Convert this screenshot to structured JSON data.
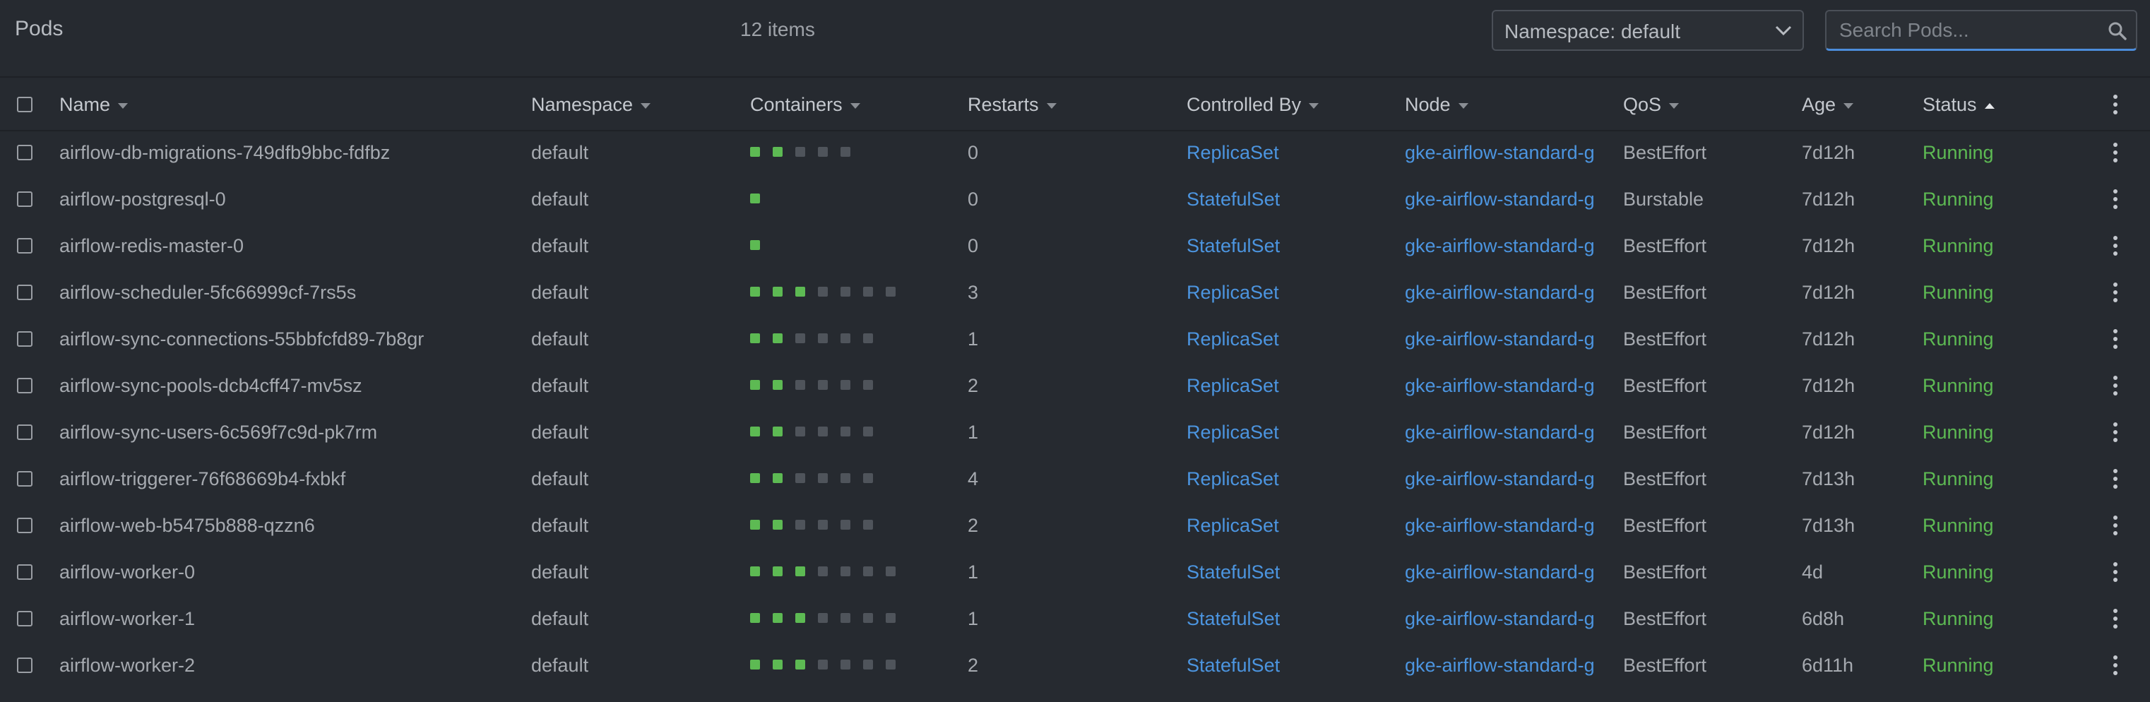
{
  "header": {
    "title": "Pods",
    "count": "12 items",
    "namespace_select": "Namespace: default",
    "search_placeholder": "Search Pods..."
  },
  "columns": {
    "name": "Name",
    "namespace": "Namespace",
    "containers": "Containers",
    "restarts": "Restarts",
    "controlled_by": "Controlled By",
    "node": "Node",
    "qos": "QoS",
    "age": "Age",
    "status": "Status"
  },
  "colors": {
    "background": "#262a30",
    "link": "#4c95e0",
    "running": "#5dba53",
    "container_ready": "#5dba53",
    "container_not_ready": "#4f545b"
  },
  "rows": [
    {
      "name": "airflow-db-migrations-749dfb9bbc-fdfbz",
      "namespace": "default",
      "containers": [
        1,
        1,
        0,
        0,
        0
      ],
      "restarts": "0",
      "controlled_by": "ReplicaSet",
      "node": "gke-airflow-standard-g",
      "qos": "BestEffort",
      "age": "7d12h",
      "status": "Running"
    },
    {
      "name": "airflow-postgresql-0",
      "namespace": "default",
      "containers": [
        1
      ],
      "restarts": "0",
      "controlled_by": "StatefulSet",
      "node": "gke-airflow-standard-g",
      "qos": "Burstable",
      "age": "7d12h",
      "status": "Running"
    },
    {
      "name": "airflow-redis-master-0",
      "namespace": "default",
      "containers": [
        1
      ],
      "restarts": "0",
      "controlled_by": "StatefulSet",
      "node": "gke-airflow-standard-g",
      "qos": "BestEffort",
      "age": "7d12h",
      "status": "Running"
    },
    {
      "name": "airflow-scheduler-5fc66999cf-7rs5s",
      "namespace": "default",
      "containers": [
        1,
        1,
        1,
        0,
        0,
        0,
        0
      ],
      "restarts": "3",
      "controlled_by": "ReplicaSet",
      "node": "gke-airflow-standard-g",
      "qos": "BestEffort",
      "age": "7d12h",
      "status": "Running"
    },
    {
      "name": "airflow-sync-connections-55bbfcfd89-7b8gr",
      "namespace": "default",
      "containers": [
        1,
        1,
        0,
        0,
        0,
        0
      ],
      "restarts": "1",
      "controlled_by": "ReplicaSet",
      "node": "gke-airflow-standard-g",
      "qos": "BestEffort",
      "age": "7d12h",
      "status": "Running"
    },
    {
      "name": "airflow-sync-pools-dcb4cff47-mv5sz",
      "namespace": "default",
      "containers": [
        1,
        1,
        0,
        0,
        0,
        0
      ],
      "restarts": "2",
      "controlled_by": "ReplicaSet",
      "node": "gke-airflow-standard-g",
      "qos": "BestEffort",
      "age": "7d12h",
      "status": "Running"
    },
    {
      "name": "airflow-sync-users-6c569f7c9d-pk7rm",
      "namespace": "default",
      "containers": [
        1,
        1,
        0,
        0,
        0,
        0
      ],
      "restarts": "1",
      "controlled_by": "ReplicaSet",
      "node": "gke-airflow-standard-g",
      "qos": "BestEffort",
      "age": "7d12h",
      "status": "Running"
    },
    {
      "name": "airflow-triggerer-76f68669b4-fxbkf",
      "namespace": "default",
      "containers": [
        1,
        1,
        0,
        0,
        0,
        0
      ],
      "restarts": "4",
      "controlled_by": "ReplicaSet",
      "node": "gke-airflow-standard-g",
      "qos": "BestEffort",
      "age": "7d13h",
      "status": "Running"
    },
    {
      "name": "airflow-web-b5475b888-qzzn6",
      "namespace": "default",
      "containers": [
        1,
        1,
        0,
        0,
        0,
        0
      ],
      "restarts": "2",
      "controlled_by": "ReplicaSet",
      "node": "gke-airflow-standard-g",
      "qos": "BestEffort",
      "age": "7d13h",
      "status": "Running"
    },
    {
      "name": "airflow-worker-0",
      "namespace": "default",
      "containers": [
        1,
        1,
        1,
        0,
        0,
        0,
        0
      ],
      "restarts": "1",
      "controlled_by": "StatefulSet",
      "node": "gke-airflow-standard-g",
      "qos": "BestEffort",
      "age": "4d",
      "status": "Running"
    },
    {
      "name": "airflow-worker-1",
      "namespace": "default",
      "containers": [
        1,
        1,
        1,
        0,
        0,
        0,
        0
      ],
      "restarts": "1",
      "controlled_by": "StatefulSet",
      "node": "gke-airflow-standard-g",
      "qos": "BestEffort",
      "age": "6d8h",
      "status": "Running"
    },
    {
      "name": "airflow-worker-2",
      "namespace": "default",
      "containers": [
        1,
        1,
        1,
        0,
        0,
        0,
        0
      ],
      "restarts": "2",
      "controlled_by": "StatefulSet",
      "node": "gke-airflow-standard-g",
      "qos": "BestEffort",
      "age": "6d11h",
      "status": "Running"
    }
  ]
}
